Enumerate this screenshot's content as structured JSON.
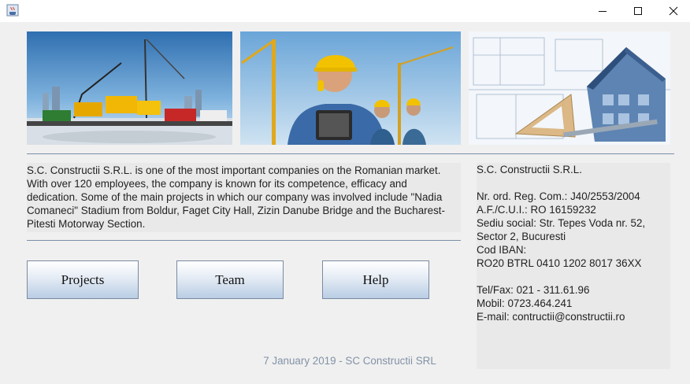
{
  "window": {
    "icon": "java-app-icon",
    "controls": [
      "minimize-icon",
      "maximize-icon",
      "close-icon"
    ]
  },
  "banner": {
    "images": [
      "construction-machinery-photo",
      "engineer-with-tablet-photo",
      "blueprint-house-model-photo"
    ]
  },
  "about": {
    "text": "S.C. Constructii S.R.L. is one of the most important companies on the Romanian market. With over 120 employees, the company is known for its competence, efficacy and dedication. Some of the main projects in which our company was involved include \"Nadia Comaneci\" Stadium from Boldur, Faget City Hall, Zizin Danube Bridge and the Bucharest-Pitesti Motorway Section."
  },
  "company": {
    "name": "S.C. Constructii S.R.L.",
    "reg_com": "Nr. ord. Reg. Com.: J40/2553/2004",
    "cui": "A.F./C.U.I.: RO 16159232",
    "address_1": "Sediu social: Str. Tepes Voda nr. 52,",
    "address_2": "Sector 2, Bucuresti",
    "iban_label": "Cod IBAN:",
    "iban": "RO20 BTRL 0410 1202 8017 36XX",
    "tel_fax": "Tel/Fax: 021 - 311.61.96",
    "mobile": "Mobil: 0723.464.241",
    "email": "E-mail: contructii@constructii.ro"
  },
  "buttons": {
    "projects": "Projects",
    "team": "Team",
    "help": "Help"
  },
  "footer": {
    "text": "7 January 2019 - SC Constructii SRL"
  },
  "colors": {
    "background": "#f0f0f0",
    "separator": "#7a8fa8",
    "footer_text": "#8292a6",
    "button_gradient_bottom": "#b9cde4"
  }
}
